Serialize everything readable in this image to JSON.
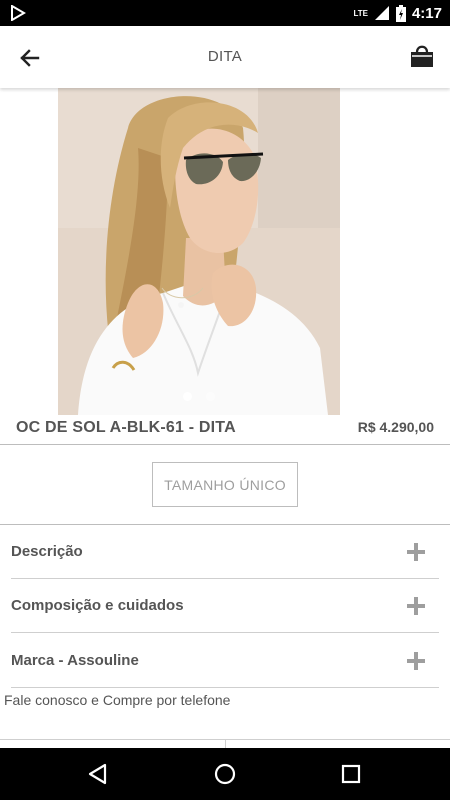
{
  "status_bar": {
    "time": "4:17",
    "network": "LTE",
    "icons": [
      "play-store-icon",
      "signal-icon",
      "battery-icon"
    ]
  },
  "app_bar": {
    "title": "DITA",
    "back_icon": "arrow-left-icon",
    "cart_icon": "shopping-bag-icon"
  },
  "product": {
    "name": "OC DE SOL A-BLK-61 - DITA",
    "price": "R$ 4.290,00",
    "image_count": 2,
    "active_image": 1,
    "size_label": "TAMANHO ÚNICO"
  },
  "accordion": [
    {
      "label": "Descrição"
    },
    {
      "label": "Composição e cuidados"
    },
    {
      "label": "Marca - Assouline"
    }
  ],
  "contact_text": "Fale conosco e Compre por telefone",
  "nav_bar": {
    "icons": [
      "back-triangle-icon",
      "home-circle-icon",
      "recents-square-icon"
    ]
  },
  "colors": {
    "text": "#555555",
    "muted": "#9e9e9e",
    "divider": "#bdbdbd",
    "photo_background": "#e9ddd2"
  }
}
